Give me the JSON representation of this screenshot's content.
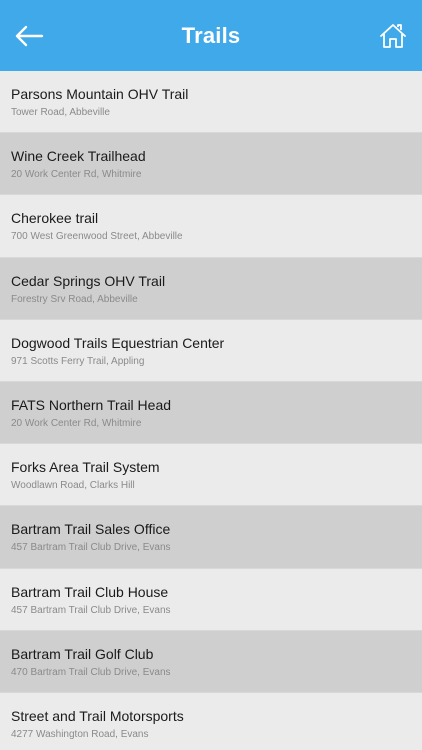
{
  "header": {
    "title": "Trails",
    "back_icon": "back-arrow-icon",
    "home_icon": "home-icon",
    "color": "#3fa9ea"
  },
  "trails": [
    {
      "name": "Parsons Mountain OHV Trail",
      "address": "Tower Road, Abbeville"
    },
    {
      "name": "Wine Creek Trailhead",
      "address": "20 Work Center Rd, Whitmire"
    },
    {
      "name": "Cherokee trail",
      "address": "700 West Greenwood Street, Abbeville"
    },
    {
      "name": "Cedar Springs OHV Trail",
      "address": "Forestry Srv Road, Abbeville"
    },
    {
      "name": "Dogwood Trails Equestrian Center",
      "address": "971 Scotts Ferry Trail, Appling"
    },
    {
      "name": "FATS Northern Trail Head",
      "address": "20 Work Center Rd, Whitmire"
    },
    {
      "name": "Forks Area Trail System",
      "address": "Woodlawn Road, Clarks Hill"
    },
    {
      "name": "Bartram Trail Sales Office",
      "address": "457 Bartram Trail Club Drive, Evans"
    },
    {
      "name": "Bartram Trail Club House",
      "address": "457 Bartram Trail Club Drive, Evans"
    },
    {
      "name": "Bartram Trail Golf Club",
      "address": "470 Bartram Trail Club Drive, Evans"
    },
    {
      "name": "Street and Trail Motorsports",
      "address": "4277 Washington Road, Evans"
    }
  ]
}
